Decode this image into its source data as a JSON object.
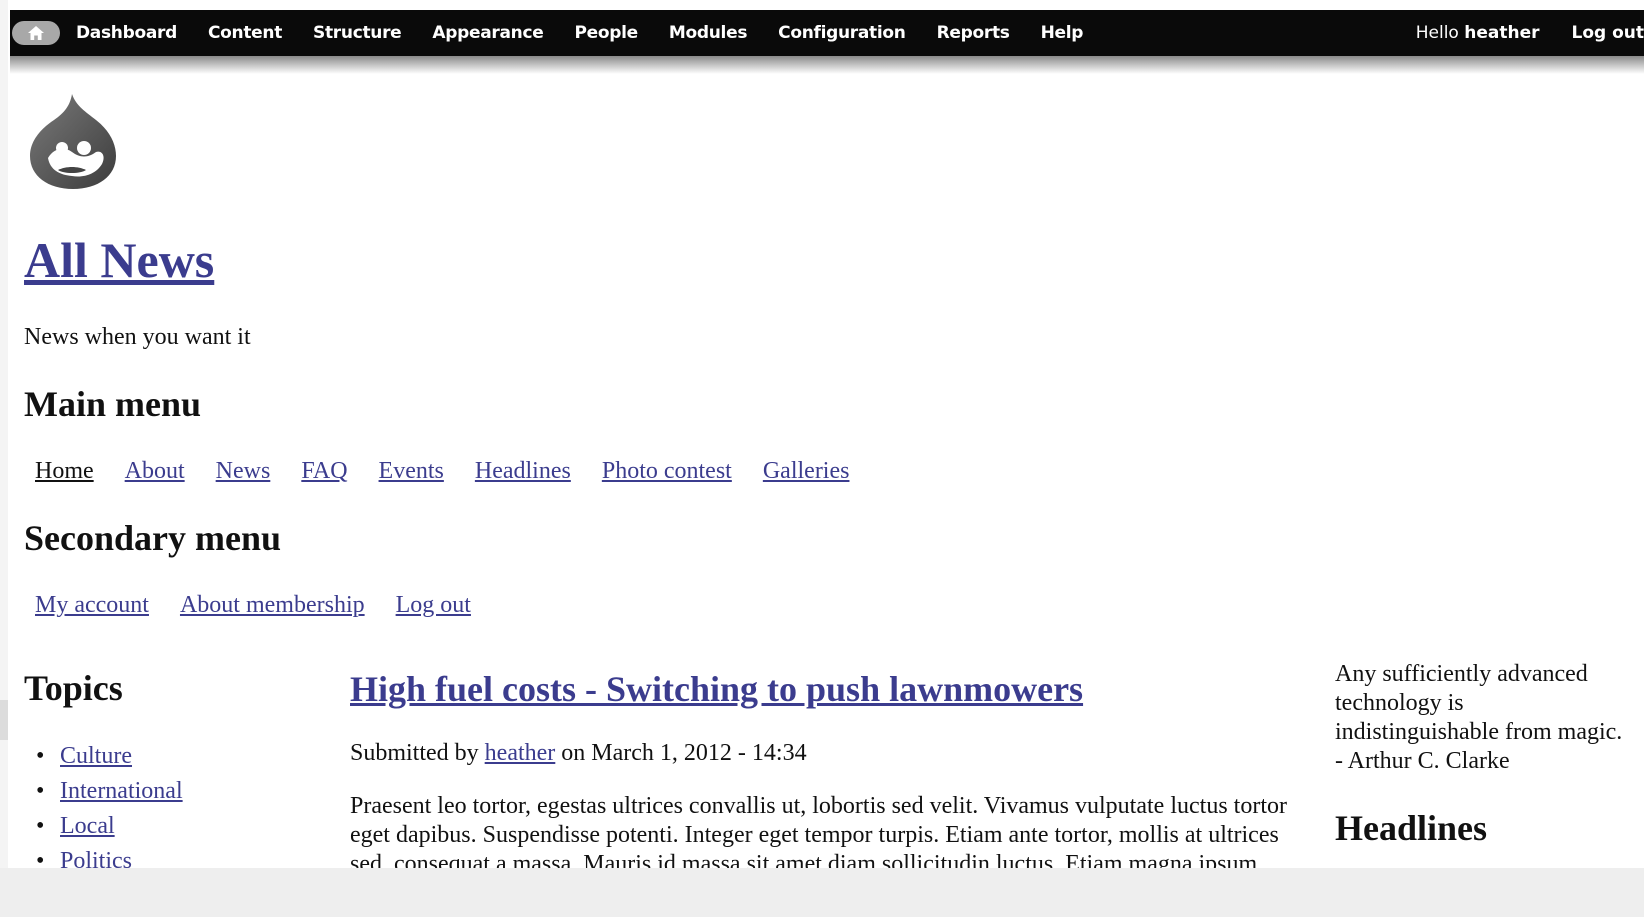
{
  "toolbar": {
    "menu": [
      "Dashboard",
      "Content",
      "Structure",
      "Appearance",
      "People",
      "Modules",
      "Configuration",
      "Reports",
      "Help"
    ],
    "hello_prefix": "Hello ",
    "username": "heather",
    "logout": "Log out"
  },
  "site": {
    "name": "All News",
    "slogan": "News when you want it"
  },
  "main_menu": {
    "heading": "Main menu",
    "items": [
      "Home",
      "About",
      "News",
      "FAQ",
      "Events",
      "Headlines",
      "Photo contest",
      "Galleries"
    ]
  },
  "secondary_menu": {
    "heading": "Secondary menu",
    "items": [
      "My account",
      "About membership",
      "Log out"
    ]
  },
  "topics": {
    "heading": "Topics",
    "items": [
      "Culture",
      "International",
      "Local",
      "Politics"
    ]
  },
  "article": {
    "title": "High fuel costs - Switching to push lawnmowers",
    "submitted_prefix": "Submitted by ",
    "author": "heather",
    "submitted_suffix": " on March 1, 2012 - 14:34",
    "body_line1": "Praesent leo tortor, egestas ultrices convallis ut, lobortis sed velit. Vivamus vulputate luctus tortor",
    "body_line2": "eget dapibus. Suspendisse potenti. Integer eget tempor turpis. Etiam ante tortor, mollis at ultrices",
    "body_line3": "sed, consequat a massa. Mauris id massa sit amet diam sollicitudin luctus. Etiam magna ipsum"
  },
  "sidebar": {
    "quote_lines": [
      "Any sufficiently advanced",
      "technology is",
      "indistinguishable from magic.",
      "- Arthur C. Clarke"
    ],
    "headlines_heading": "Headlines"
  },
  "colors": {
    "toolbar_bg": "#0a0a0a",
    "link": "#3b3c8e",
    "text": "#111111"
  }
}
